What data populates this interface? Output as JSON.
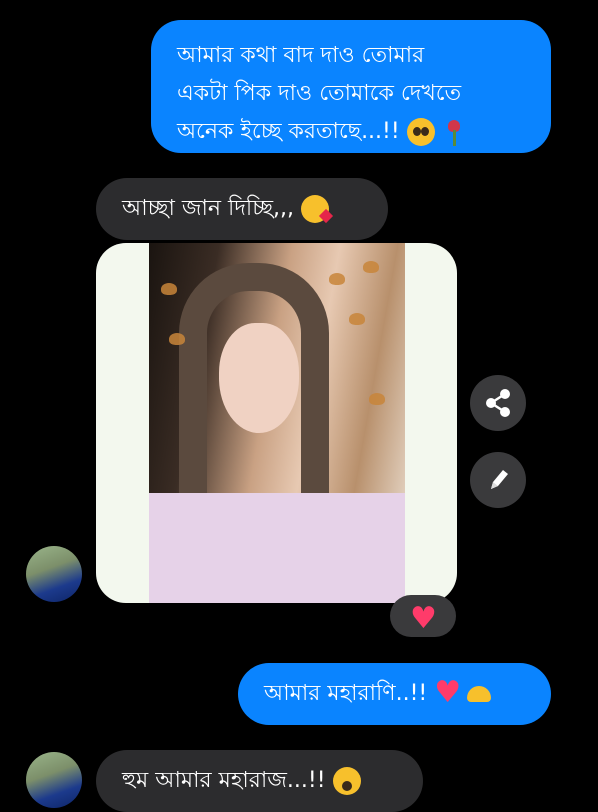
{
  "messages": [
    {
      "direction": "outgoing",
      "lines": [
        "আমার কথা বাদ দাও তোমার",
        "একটা পিক দাও তোমাকে দেখতে",
        "অনেক ইচ্ছে করতাছে...!!"
      ],
      "emojis": [
        "pleading-face",
        "wilted-rose"
      ]
    },
    {
      "direction": "incoming",
      "text": "আচ্ছা জান দিচ্ছি,,,",
      "emojis": [
        "kiss-face"
      ]
    },
    {
      "direction": "incoming",
      "type": "photo",
      "reaction": "red-heart"
    },
    {
      "direction": "outgoing",
      "text": "আমার মহারাণি..!!",
      "emojis": [
        "heart-with-arrow",
        "heart-hands"
      ]
    },
    {
      "direction": "incoming",
      "text": "হুম আমার মহারাজ...!!",
      "emojis": [
        "face-with-hand-over-mouth"
      ]
    }
  ],
  "photo_actions": [
    "share",
    "edit"
  ],
  "colors": {
    "outgoing_bubble": "#0a84ff",
    "incoming_bubble": "#2c2c2e",
    "background": "#000000",
    "action_button": "#3a3a3c"
  }
}
